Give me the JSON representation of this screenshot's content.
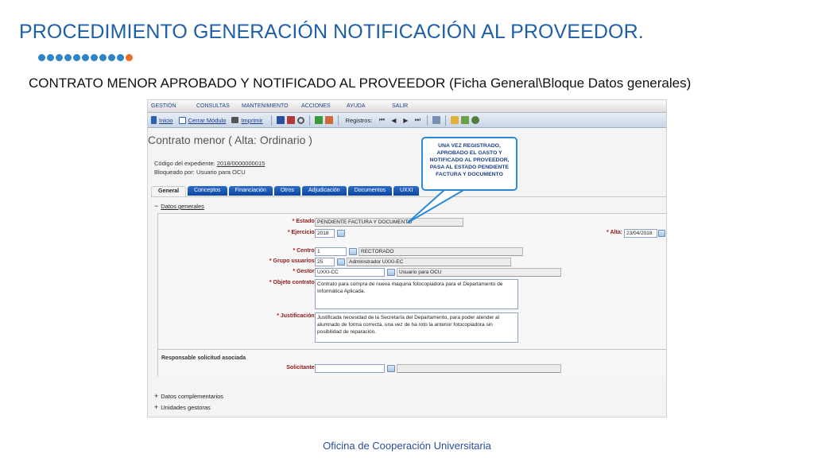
{
  "slide": {
    "title": "PROCEDIMIENTO GENERACIÓN NOTIFICACIÓN AL PROVEEDOR.",
    "subtitle": "CONTRATO MENOR APROBADO Y NOTIFICADO AL PROVEEDOR (Ficha General\\Bloque Datos generales)",
    "footer": "Oficina de Cooperación Universitaria",
    "colors": {
      "title": "#1f5fa8",
      "dot_blue": "#2e86c9",
      "dot_orange": "#f06b23"
    }
  },
  "app": {
    "menu": [
      "GESTIÓN",
      "CONSULTAS",
      "MANTENIMIENTO",
      "ACCIONES",
      "AYUDA",
      "SALIR"
    ],
    "toolbar": {
      "inicio": "Inicio",
      "cerrar_modulo": "Cerrar Módulo",
      "imprimir": "Imprimir",
      "registros": "Registros:"
    },
    "form_title": "Contrato menor ( Alta: Ordinario )",
    "expediente_label": "Código del expediente:",
    "expediente_value": "2018/0000000015",
    "bloqueado": "Bloqueado por: Usuario para OCU",
    "tabs": [
      "General",
      "Conceptos",
      "Financiación",
      "Otros",
      "Adjudicación",
      "Documentos",
      "UXXI"
    ],
    "sections": {
      "datos_generales": "Datos generales",
      "datos_complementarios": "Datos complementarios",
      "unidades_gestoras": "Unidades gestoras",
      "responsable": "Responsable solicitud asociada"
    },
    "fields": {
      "estado_label": "Estado:",
      "estado_value": "PENDIENTE FACTURA Y DOCUMENTO",
      "ejercicio_label": "Ejercicio:",
      "ejercicio_value": "2018",
      "alta_label": "Alta:",
      "alta_value": "23/04/2018",
      "centro_label": "Centro:",
      "centro_code": "1",
      "centro_name": "RECTORADO",
      "grupo_label": "Grupo usuarios:",
      "grupo_code": "25",
      "grupo_name": "Administrador UXXI-EC",
      "gestor_label": "Gestor:",
      "gestor_code": "UXXI-CC",
      "gestor_name": "Usuario para OCU",
      "objeto_label": "Objeto contrato:",
      "objeto_value": "Contrato para compra de nueva maquina fotocopiadora para el Departamento de Informática Aplicada.",
      "justificacion_label": "Justificación:",
      "justificacion_value": "Justificada necesidad de la Secretaría del Departamento, para poder atender al alumnado de forma correcta, una vez de ha roto la anterior fotocopiadora sin posibilidad de reparación.",
      "solicitante_label": "Solicitante:",
      "solicitante_value": ""
    },
    "callout": "UNA VEZ REGISTRADO, APROBADO EL GASTO Y NOTIFICADO AL PROVEEDOR, PASA AL ESTADO PENDIENTE FACTURA Y DOCUMENTO"
  }
}
